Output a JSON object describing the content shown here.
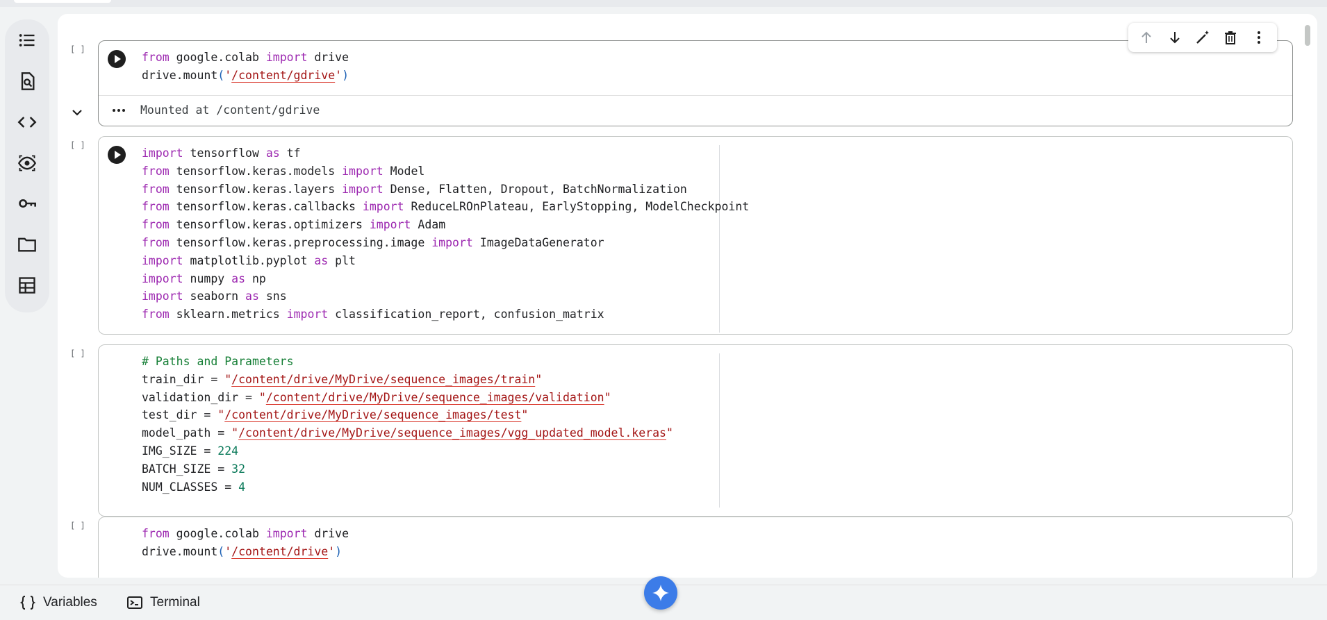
{
  "sidebar": {
    "items": [
      {
        "icon": "table-of-contents-icon"
      },
      {
        "icon": "find-replace-icon"
      },
      {
        "icon": "code-snippets-icon"
      },
      {
        "icon": "visibility-icon"
      },
      {
        "icon": "secrets-key-icon"
      },
      {
        "icon": "folder-icon"
      },
      {
        "icon": "data-table-icon"
      }
    ]
  },
  "cells": [
    {
      "exec_count": "[ ]",
      "lines": [
        [
          [
            "kw",
            "from"
          ],
          [
            "plain",
            " google.colab "
          ],
          [
            "kw",
            "import"
          ],
          [
            "plain",
            " drive"
          ]
        ],
        [
          [
            "plain",
            "drive.mount"
          ],
          [
            "paren",
            "("
          ],
          [
            "str",
            "'"
          ],
          [
            "path",
            "/content/gdrive"
          ],
          [
            "str",
            "'"
          ],
          [
            "paren",
            ")"
          ]
        ]
      ],
      "output": "Mounted at /content/gdrive"
    },
    {
      "exec_count": "[ ]",
      "lines": [
        [
          [
            "kw",
            "import"
          ],
          [
            "plain",
            " tensorflow "
          ],
          [
            "kw",
            "as"
          ],
          [
            "plain",
            " tf"
          ]
        ],
        [
          [
            "kw",
            "from"
          ],
          [
            "plain",
            " tensorflow.keras.models "
          ],
          [
            "kw",
            "import"
          ],
          [
            "plain",
            " Model"
          ]
        ],
        [
          [
            "kw",
            "from"
          ],
          [
            "plain",
            " tensorflow.keras.layers "
          ],
          [
            "kw",
            "import"
          ],
          [
            "plain",
            " Dense, Flatten, Dropout, BatchNormalization"
          ]
        ],
        [
          [
            "kw",
            "from"
          ],
          [
            "plain",
            " tensorflow.keras.callbacks "
          ],
          [
            "kw",
            "import"
          ],
          [
            "plain",
            " ReduceLROnPlateau, EarlyStopping, ModelCheckpoint"
          ]
        ],
        [
          [
            "kw",
            "from"
          ],
          [
            "plain",
            " tensorflow.keras.optimizers "
          ],
          [
            "kw",
            "import"
          ],
          [
            "plain",
            " Adam"
          ]
        ],
        [
          [
            "kw",
            "from"
          ],
          [
            "plain",
            " tensorflow.keras.preprocessing.image "
          ],
          [
            "kw",
            "import"
          ],
          [
            "plain",
            " ImageDataGenerator"
          ]
        ],
        [
          [
            "kw",
            "import"
          ],
          [
            "plain",
            " matplotlib.pyplot "
          ],
          [
            "kw",
            "as"
          ],
          [
            "plain",
            " plt"
          ]
        ],
        [
          [
            "kw",
            "import"
          ],
          [
            "plain",
            " numpy "
          ],
          [
            "kw",
            "as"
          ],
          [
            "plain",
            " np"
          ]
        ],
        [
          [
            "kw",
            "import"
          ],
          [
            "plain",
            " seaborn "
          ],
          [
            "kw",
            "as"
          ],
          [
            "plain",
            " sns"
          ]
        ],
        [
          [
            "kw",
            "from"
          ],
          [
            "plain",
            " sklearn.metrics "
          ],
          [
            "kw",
            "import"
          ],
          [
            "plain",
            " classification_report, confusion_matrix"
          ]
        ]
      ]
    },
    {
      "exec_count": "[ ]",
      "lines": [
        [
          [
            "cm",
            "# Paths and Parameters"
          ]
        ],
        [
          [
            "plain",
            "train_dir = "
          ],
          [
            "str",
            "\""
          ],
          [
            "path",
            "/content/drive/MyDrive/sequence_images/train"
          ],
          [
            "str",
            "\""
          ]
        ],
        [
          [
            "plain",
            "validation_dir = "
          ],
          [
            "str",
            "\""
          ],
          [
            "path",
            "/content/drive/MyDrive/sequence_images/validation"
          ],
          [
            "str",
            "\""
          ]
        ],
        [
          [
            "plain",
            "test_dir = "
          ],
          [
            "str",
            "\""
          ],
          [
            "path",
            "/content/drive/MyDrive/sequence_images/test"
          ],
          [
            "str",
            "\""
          ]
        ],
        [
          [
            "plain",
            "model_path = "
          ],
          [
            "str",
            "\""
          ],
          [
            "path",
            "/content/drive/MyDrive/sequence_images/vgg_updated_model.keras"
          ],
          [
            "str",
            "\""
          ]
        ],
        [
          [
            "plain",
            "IMG_SIZE = "
          ],
          [
            "num",
            "224"
          ]
        ],
        [
          [
            "plain",
            "BATCH_SIZE = "
          ],
          [
            "num",
            "32"
          ]
        ],
        [
          [
            "plain",
            "NUM_CLASSES = "
          ],
          [
            "num",
            "4"
          ]
        ]
      ]
    },
    {
      "exec_count": "[ ]",
      "lines": [
        [
          [
            "kw",
            "from"
          ],
          [
            "plain",
            " google.colab "
          ],
          [
            "kw",
            "import"
          ],
          [
            "plain",
            " drive"
          ]
        ],
        [
          [
            "plain",
            "drive.mount"
          ],
          [
            "paren",
            "("
          ],
          [
            "str",
            "'"
          ],
          [
            "path",
            "/content/drive"
          ],
          [
            "str",
            "'"
          ],
          [
            "paren",
            ")"
          ]
        ]
      ]
    }
  ],
  "cell_toolbar": {
    "buttons": [
      "move-up-icon",
      "move-down-icon",
      "edit-magic-icon",
      "delete-icon",
      "more-options-icon"
    ]
  },
  "bottombar": {
    "variables_label": "Variables",
    "terminal_label": "Terminal"
  }
}
